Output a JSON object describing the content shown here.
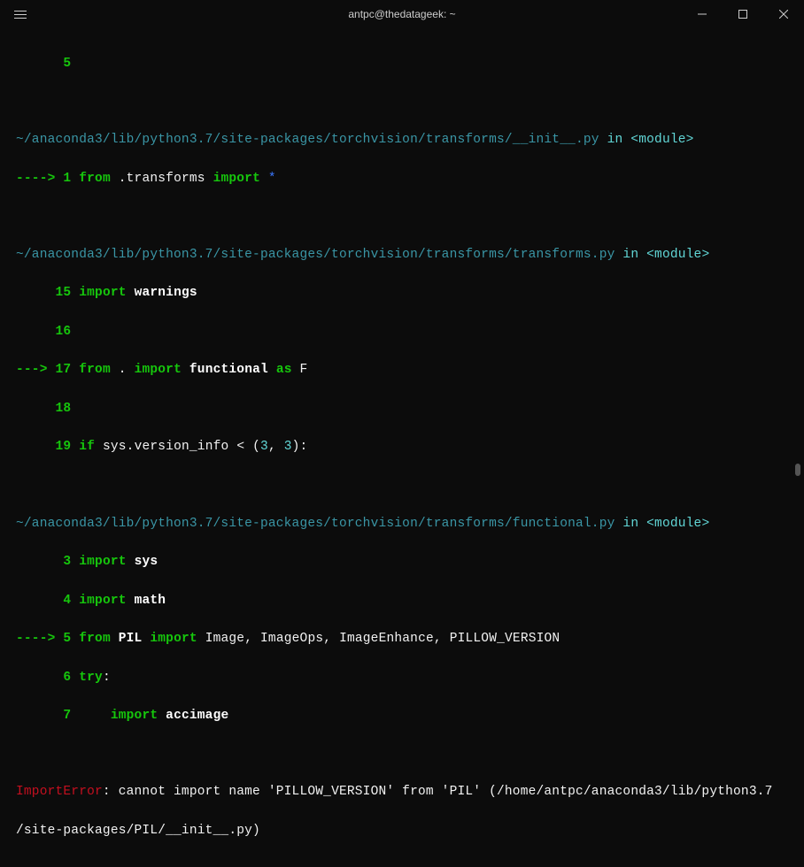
{
  "window": {
    "title": "antpc@thedatageek: ~"
  },
  "lines": {
    "l0_num": "5",
    "path1": "~/anaconda3/lib/python3.7/site-packages/torchvision/transforms/__init__.py",
    "in": "in",
    "module": "<module>",
    "arrow": "---->",
    "arrow2": "--->",
    "l1_num": "1",
    "l1_from": "from",
    "l1_dot": ".",
    "l1_transforms": "transforms",
    "l1_import": "import",
    "l1_star": "*",
    "path2": "~/anaconda3/lib/python3.7/site-packages/torchvision/transforms/transforms.py",
    "l15_num": "15",
    "l15_import": "import",
    "l15_warnings": "warnings",
    "l16_num": "16",
    "l17_num": "17",
    "l17_from": "from",
    "l17_dot": ".",
    "l17_import": "import",
    "l17_functional": "functional",
    "l17_as": "as",
    "l17_F": "F",
    "l18_num": "18",
    "l19_num": "19",
    "l19_if": "if",
    "l19_sys": "sys",
    "l19_dot": ".",
    "l19_vinfo": "version_info",
    "l19_lt": "<",
    "l19_paren": "(",
    "l19_3a": "3",
    "l19_comma": ",",
    "l19_3b": "3",
    "l19_paren2": "):",
    "path3": "~/anaconda3/lib/python3.7/site-packages/torchvision/transforms/functional.py",
    "l3_num": "3",
    "l3_import": "import",
    "l3_sys": "sys",
    "l4_num": "4",
    "l4_import": "import",
    "l4_math": "math",
    "l5_num": "5",
    "l5_from": "from",
    "l5_PIL": "PIL",
    "l5_import": "import",
    "l5_Image": "Image",
    "l5_comma1": ",",
    "l5_ImageOps": "ImageOps",
    "l5_comma2": ",",
    "l5_ImageEnhance": "ImageEnhance",
    "l5_comma3": ",",
    "l5_PV": "PILLOW_VERSION",
    "l6_num": "6",
    "l6_try": "try",
    "l6_colon": ":",
    "l7_num": "7",
    "l7_import": "import",
    "l7_accimage": "accimage",
    "err_name": "ImportError",
    "err_msg": ": cannot import name 'PILLOW_VERSION' from 'PIL' (/home/antpc/anaconda3/lib/python3.7",
    "err_msg2": "/site-packages/PIL/__init__.py)"
  }
}
